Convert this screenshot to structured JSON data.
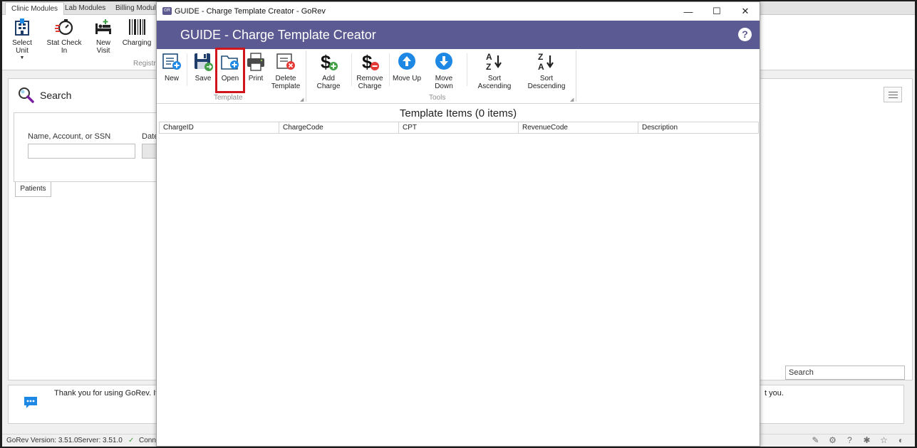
{
  "background_app": {
    "module_tabs": [
      "Clinic Modules",
      "Lab Modules",
      "Billing Modules"
    ],
    "ribbon_buttons": [
      {
        "label": "Select Unit",
        "icon": "hospital-icon"
      },
      {
        "label": "Stat Check In",
        "icon": "stopwatch-icon"
      },
      {
        "label": "New Visit",
        "icon": "bed-icon"
      },
      {
        "label": "Charging",
        "icon": "barcode-icon"
      }
    ],
    "ribbon_group_label": "Registra",
    "search": {
      "title": "Search",
      "field_label": "Name, Account, or SSN",
      "field_label_2": "Date",
      "tab": "Patients",
      "search_box_placeholder": "Search"
    },
    "message": {
      "text": "Thank you for using GoRev.  It",
      "text_end": "t you."
    },
    "status_bar": {
      "version": "GoRev Version: 3.51.0",
      "server": "Server: 3.51.0",
      "connection": "Conn"
    }
  },
  "dialog": {
    "window_title": "GUIDE - Charge Template Creator - GoRev",
    "banner_title": "GUIDE - Charge Template Creator",
    "ribbon": {
      "template_group_label": "Template",
      "tools_group_label": "Tools",
      "buttons": {
        "new": "New",
        "save": "Save",
        "open": "Open",
        "print": "Print",
        "delete_template": "Delete Template",
        "add_charge": "Add Charge",
        "remove_charge": "Remove Charge",
        "move_up": "Move Up",
        "move_down": "Move Down",
        "sort_ascending": "Sort Ascending",
        "sort_descending": "Sort Descending"
      }
    },
    "grid": {
      "title": "Template Items (0 items)",
      "columns": [
        "ChargeID",
        "ChargeCode",
        "CPT",
        "RevenueCode",
        "Description"
      ],
      "rows": []
    }
  },
  "colors": {
    "banner": "#5c5a92",
    "highlight": "#d0161a",
    "accent_blue": "#1e88e5"
  }
}
